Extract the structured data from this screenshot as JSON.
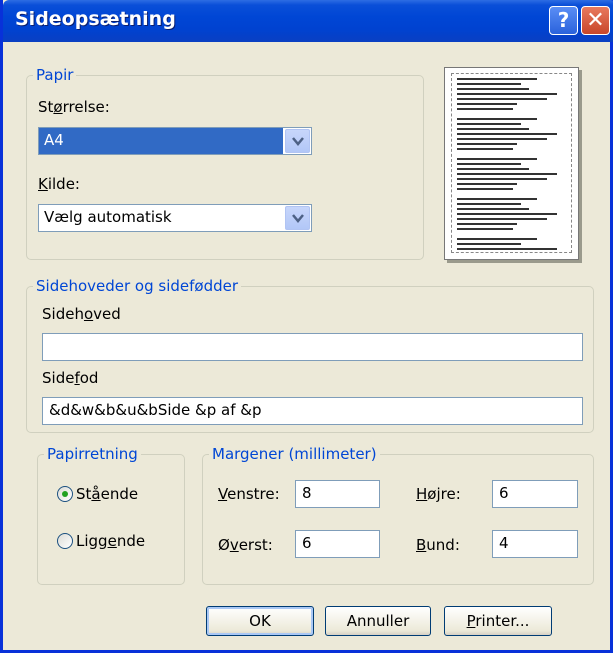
{
  "window": {
    "title": "Sideopsætning",
    "help_label": "?",
    "close_label": "✕",
    "title_color": "#0046d5"
  },
  "paper": {
    "legend": "Papir",
    "size_label_pre": "St",
    "size_label_acc": "ø",
    "size_label_post": "rrelse:",
    "size_value": "A4",
    "source_label_pre": "",
    "source_label_acc": "K",
    "source_label_post": "ilde:",
    "source_value": "Vælg automatisk"
  },
  "headers": {
    "legend": "Sidehoveder og sidefødder",
    "header_label_pre": "Sideh",
    "header_label_acc": "o",
    "header_label_post": "ved",
    "header_value": "",
    "footer_label_pre": "Side",
    "footer_label_acc": "f",
    "footer_label_post": "od",
    "footer_value": "&d&w&b&u&bSide &p af &p"
  },
  "orientation": {
    "legend": "Papirretning",
    "portrait_pre": "St",
    "portrait_acc": "å",
    "portrait_post": "ende",
    "landscape_pre": "Ligg",
    "landscape_acc": "e",
    "landscape_post": "nde",
    "selected": "portrait"
  },
  "margins": {
    "legend": "Margener (millimeter)",
    "left_acc": "V",
    "left_post": "enstre:",
    "left_value": "8",
    "right_acc": "H",
    "right_post": "øjre:",
    "right_value": "6",
    "top_pre": "Ø",
    "top_acc": "v",
    "top_post": "erst:",
    "top_value": "6",
    "bottom_acc": "B",
    "bottom_post": "und:",
    "bottom_value": "4"
  },
  "buttons": {
    "ok": "OK",
    "cancel": "Annuller",
    "printer_acc": "P",
    "printer_post": "rinter..."
  }
}
